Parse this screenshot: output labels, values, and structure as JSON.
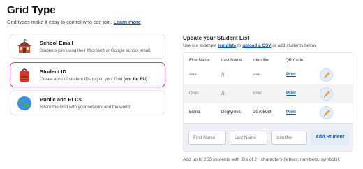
{
  "header": {
    "title": "Grid Type",
    "subtitle": "Grid types make it easy to control who can join.",
    "learn_more": "Learn more"
  },
  "grid_types": [
    {
      "title": "School Email",
      "description": "Students join using their Microsoft or Google school email.",
      "suffix": "",
      "icon": "school-icon",
      "selected": false
    },
    {
      "title": "Student ID",
      "description": "Create a list of student IDs to join your Grid",
      "suffix": "[not for EU]",
      "icon": "backpack-icon",
      "selected": true
    },
    {
      "title": "Public and PLCs",
      "description": "Share the Grid with your network and the world",
      "suffix": "",
      "icon": "globe-icon",
      "selected": false
    }
  ],
  "student_list": {
    "title": "Update your Student List",
    "sub_prefix": "Use our example",
    "template_link": "template",
    "sub_mid": "to",
    "upload_link": "upload a CSV",
    "sub_suffix": "or add students below",
    "columns": [
      "First Name",
      "Last Name",
      "Identifier",
      "QR Code"
    ],
    "rows": [
      {
        "first": "Аня",
        "last": "Д",
        "id": "аня",
        "qr": "Print",
        "filled": false
      },
      {
        "first": "Олег",
        "last": "Д",
        "id": "олег",
        "qr": "Print",
        "filled": false
      },
      {
        "first": "Elena",
        "last": "Degtyreva",
        "id": "397959bf",
        "qr": "Print",
        "filled": true
      }
    ],
    "inputs": {
      "first_placeholder": "First Name",
      "last_placeholder": "Last Name",
      "id_placeholder": "Identifier"
    },
    "add_button": "Add Student",
    "footer": "Add up to 250 students with IDs of 2+ characters (letters, numbers, symbols)."
  },
  "colors": {
    "accent_pink": "#d43a8a",
    "link_blue": "#0a5ab5"
  }
}
